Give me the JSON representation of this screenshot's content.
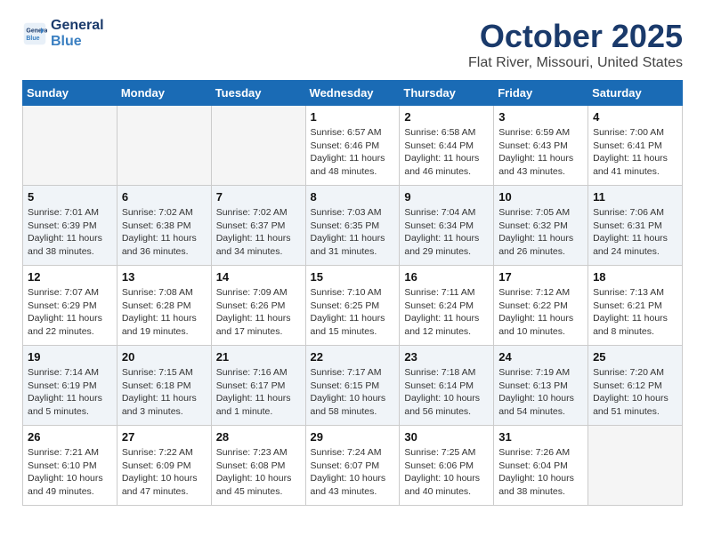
{
  "header": {
    "logo_line1": "General",
    "logo_line2": "Blue",
    "month": "October 2025",
    "location": "Flat River, Missouri, United States"
  },
  "days_of_week": [
    "Sunday",
    "Monday",
    "Tuesday",
    "Wednesday",
    "Thursday",
    "Friday",
    "Saturday"
  ],
  "weeks": [
    [
      {
        "day": "",
        "info": ""
      },
      {
        "day": "",
        "info": ""
      },
      {
        "day": "",
        "info": ""
      },
      {
        "day": "1",
        "info": "Sunrise: 6:57 AM\nSunset: 6:46 PM\nDaylight: 11 hours\nand 48 minutes."
      },
      {
        "day": "2",
        "info": "Sunrise: 6:58 AM\nSunset: 6:44 PM\nDaylight: 11 hours\nand 46 minutes."
      },
      {
        "day": "3",
        "info": "Sunrise: 6:59 AM\nSunset: 6:43 PM\nDaylight: 11 hours\nand 43 minutes."
      },
      {
        "day": "4",
        "info": "Sunrise: 7:00 AM\nSunset: 6:41 PM\nDaylight: 11 hours\nand 41 minutes."
      }
    ],
    [
      {
        "day": "5",
        "info": "Sunrise: 7:01 AM\nSunset: 6:39 PM\nDaylight: 11 hours\nand 38 minutes."
      },
      {
        "day": "6",
        "info": "Sunrise: 7:02 AM\nSunset: 6:38 PM\nDaylight: 11 hours\nand 36 minutes."
      },
      {
        "day": "7",
        "info": "Sunrise: 7:02 AM\nSunset: 6:37 PM\nDaylight: 11 hours\nand 34 minutes."
      },
      {
        "day": "8",
        "info": "Sunrise: 7:03 AM\nSunset: 6:35 PM\nDaylight: 11 hours\nand 31 minutes."
      },
      {
        "day": "9",
        "info": "Sunrise: 7:04 AM\nSunset: 6:34 PM\nDaylight: 11 hours\nand 29 minutes."
      },
      {
        "day": "10",
        "info": "Sunrise: 7:05 AM\nSunset: 6:32 PM\nDaylight: 11 hours\nand 26 minutes."
      },
      {
        "day": "11",
        "info": "Sunrise: 7:06 AM\nSunset: 6:31 PM\nDaylight: 11 hours\nand 24 minutes."
      }
    ],
    [
      {
        "day": "12",
        "info": "Sunrise: 7:07 AM\nSunset: 6:29 PM\nDaylight: 11 hours\nand 22 minutes."
      },
      {
        "day": "13",
        "info": "Sunrise: 7:08 AM\nSunset: 6:28 PM\nDaylight: 11 hours\nand 19 minutes."
      },
      {
        "day": "14",
        "info": "Sunrise: 7:09 AM\nSunset: 6:26 PM\nDaylight: 11 hours\nand 17 minutes."
      },
      {
        "day": "15",
        "info": "Sunrise: 7:10 AM\nSunset: 6:25 PM\nDaylight: 11 hours\nand 15 minutes."
      },
      {
        "day": "16",
        "info": "Sunrise: 7:11 AM\nSunset: 6:24 PM\nDaylight: 11 hours\nand 12 minutes."
      },
      {
        "day": "17",
        "info": "Sunrise: 7:12 AM\nSunset: 6:22 PM\nDaylight: 11 hours\nand 10 minutes."
      },
      {
        "day": "18",
        "info": "Sunrise: 7:13 AM\nSunset: 6:21 PM\nDaylight: 11 hours\nand 8 minutes."
      }
    ],
    [
      {
        "day": "19",
        "info": "Sunrise: 7:14 AM\nSunset: 6:19 PM\nDaylight: 11 hours\nand 5 minutes."
      },
      {
        "day": "20",
        "info": "Sunrise: 7:15 AM\nSunset: 6:18 PM\nDaylight: 11 hours\nand 3 minutes."
      },
      {
        "day": "21",
        "info": "Sunrise: 7:16 AM\nSunset: 6:17 PM\nDaylight: 11 hours\nand 1 minute."
      },
      {
        "day": "22",
        "info": "Sunrise: 7:17 AM\nSunset: 6:15 PM\nDaylight: 10 hours\nand 58 minutes."
      },
      {
        "day": "23",
        "info": "Sunrise: 7:18 AM\nSunset: 6:14 PM\nDaylight: 10 hours\nand 56 minutes."
      },
      {
        "day": "24",
        "info": "Sunrise: 7:19 AM\nSunset: 6:13 PM\nDaylight: 10 hours\nand 54 minutes."
      },
      {
        "day": "25",
        "info": "Sunrise: 7:20 AM\nSunset: 6:12 PM\nDaylight: 10 hours\nand 51 minutes."
      }
    ],
    [
      {
        "day": "26",
        "info": "Sunrise: 7:21 AM\nSunset: 6:10 PM\nDaylight: 10 hours\nand 49 minutes."
      },
      {
        "day": "27",
        "info": "Sunrise: 7:22 AM\nSunset: 6:09 PM\nDaylight: 10 hours\nand 47 minutes."
      },
      {
        "day": "28",
        "info": "Sunrise: 7:23 AM\nSunset: 6:08 PM\nDaylight: 10 hours\nand 45 minutes."
      },
      {
        "day": "29",
        "info": "Sunrise: 7:24 AM\nSunset: 6:07 PM\nDaylight: 10 hours\nand 43 minutes."
      },
      {
        "day": "30",
        "info": "Sunrise: 7:25 AM\nSunset: 6:06 PM\nDaylight: 10 hours\nand 40 minutes."
      },
      {
        "day": "31",
        "info": "Sunrise: 7:26 AM\nSunset: 6:04 PM\nDaylight: 10 hours\nand 38 minutes."
      },
      {
        "day": "",
        "info": ""
      }
    ]
  ]
}
